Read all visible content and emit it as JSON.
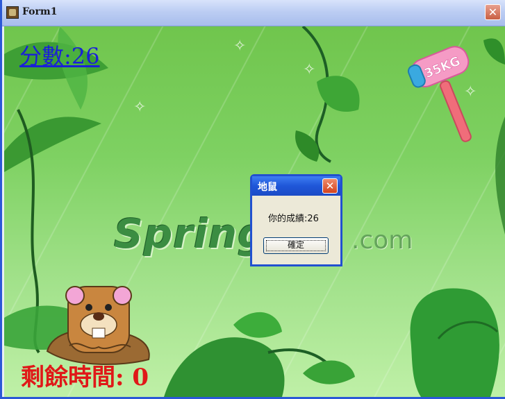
{
  "window": {
    "title": "Form1",
    "close_symbol": "✕"
  },
  "game": {
    "score_text": "分數:26",
    "time_text": "剩餘時間: 0",
    "hammer_label": "35KG",
    "watermark_left": "Spring",
    "watermark_right": ".com"
  },
  "dialog": {
    "title": "地鼠",
    "close_symbol": "✕",
    "message": "你的成績:26",
    "ok_label": "確定"
  },
  "colors": {
    "score": "#1a20d8",
    "time": "#e01818",
    "titlebar_accent": "#2150d0"
  },
  "icons": [
    "app-icon",
    "close-icon",
    "hammer-icon",
    "mole-icon"
  ]
}
